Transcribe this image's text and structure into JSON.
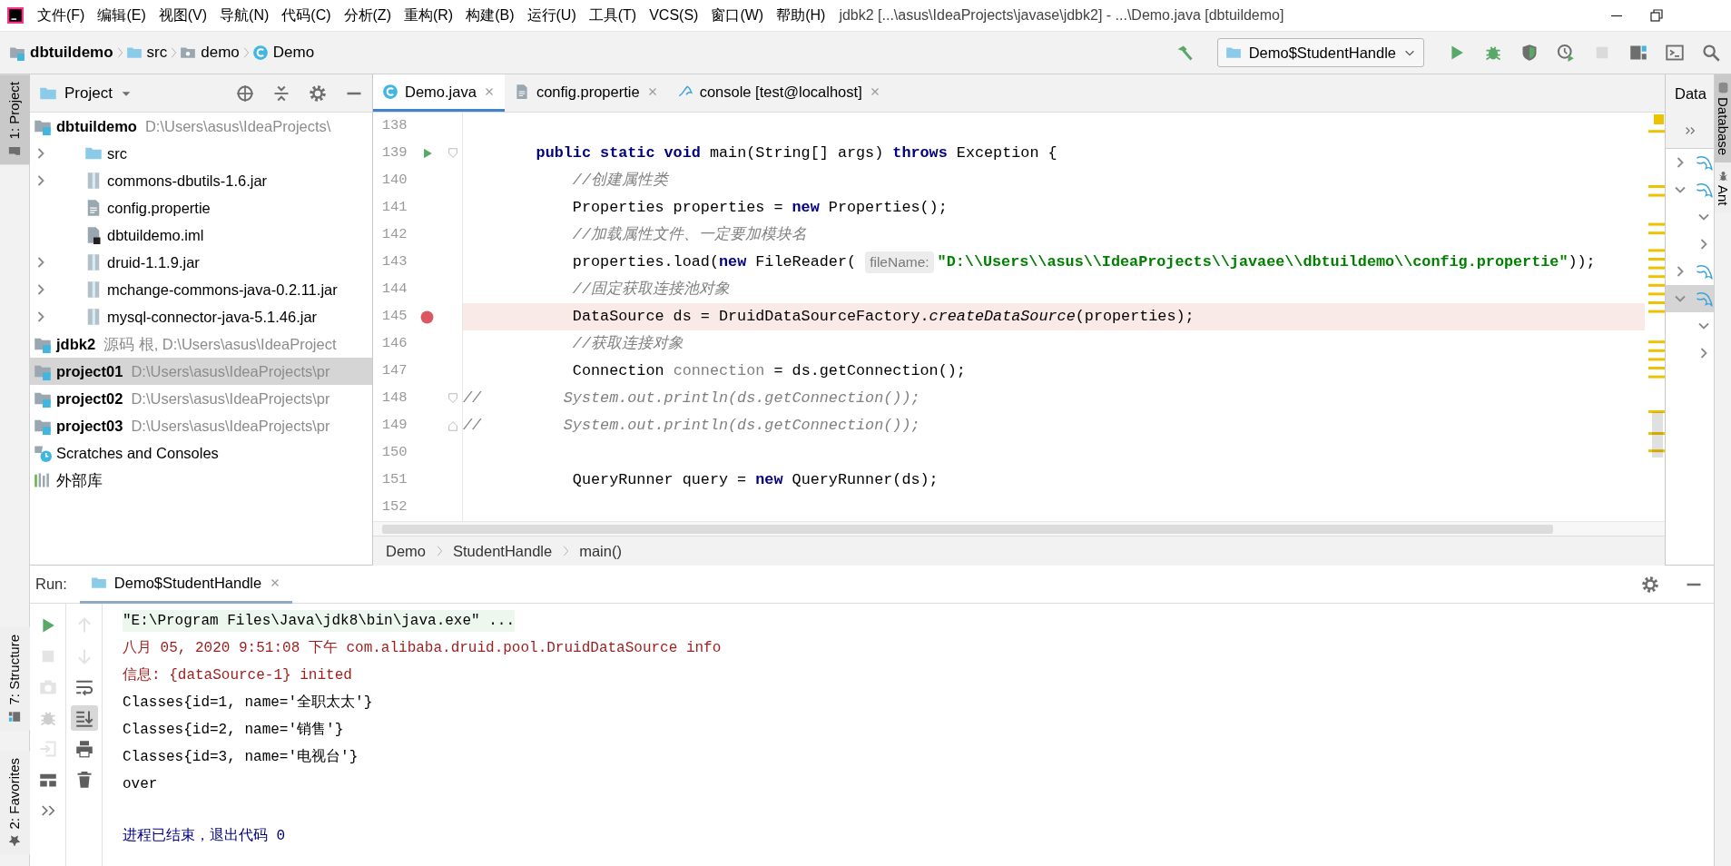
{
  "app_menu": [
    "文件(F)",
    "编辑(E)",
    "视图(V)",
    "导航(N)",
    "代码(C)",
    "分析(Z)",
    "重构(R)",
    "构建(B)",
    "运行(U)",
    "工具(T)",
    "VCS(S)",
    "窗口(W)",
    "帮助(H)"
  ],
  "window_title": "jdbk2 [...\\asus\\IdeaProjects\\javase\\jdbk2] - ...\\Demo.java [dbtuildemo]",
  "breadcrumb": [
    {
      "label": "dbtuildemo",
      "kind": "module"
    },
    {
      "label": "src",
      "kind": "folder"
    },
    {
      "label": "demo",
      "kind": "package"
    },
    {
      "label": "Demo",
      "kind": "class"
    }
  ],
  "run_config": "Demo$StudentHandle",
  "toolbar": [
    {
      "kind": "build",
      "disabled": false
    },
    {
      "kind": "run",
      "disabled": false
    },
    {
      "kind": "debug",
      "disabled": false
    },
    {
      "kind": "coverage",
      "disabled": false
    },
    {
      "kind": "profile",
      "disabled": false
    },
    {
      "kind": "stop",
      "disabled": true
    },
    {
      "kind": "structure",
      "disabled": false
    },
    {
      "kind": "terminal",
      "disabled": false
    },
    {
      "kind": "search",
      "disabled": false
    }
  ],
  "left_stripe": [
    {
      "label": "1: Project",
      "kind": "project",
      "selected": true
    },
    {
      "label": "7: Structure",
      "kind": "structure",
      "selected": false
    },
    {
      "label": "2: Favorites",
      "kind": "favorites",
      "selected": false
    }
  ],
  "right_stripe": [
    {
      "label": "Database",
      "kind": "database",
      "selected": true
    },
    {
      "label": "Ant",
      "kind": "ant",
      "selected": false
    }
  ],
  "project_panel": {
    "title": "Project",
    "tree": [
      {
        "label": "dbtuildemo",
        "path": "D:\\Users\\asus\\IdeaProjects\\",
        "kind": "module",
        "selected": false,
        "children": [
          {
            "label": "src",
            "kind": "folder",
            "expanded": false,
            "selected": false
          },
          {
            "label": "commons-dbutils-1.6.jar",
            "kind": "jar",
            "expanded": false,
            "selected": false
          },
          {
            "label": "config.propertie",
            "kind": "file",
            "selected": false
          },
          {
            "label": "dbtuildemo.iml",
            "kind": "iml",
            "selected": false
          },
          {
            "label": "druid-1.1.9.jar",
            "kind": "jar",
            "expanded": false,
            "selected": false
          },
          {
            "label": "mchange-commons-java-0.2.11.jar",
            "kind": "jar",
            "expanded": false,
            "selected": false
          },
          {
            "label": "mysql-connector-java-5.1.46.jar",
            "kind": "jar",
            "expanded": false,
            "selected": false
          }
        ]
      },
      {
        "label": "jdbk2",
        "path": "源码 根, D:\\Users\\asus\\IdeaProject",
        "kind": "module",
        "selected": false
      },
      {
        "label": "project01",
        "path": "D:\\Users\\asus\\IdeaProjects\\pr",
        "kind": "module",
        "selected": true
      },
      {
        "label": "project02",
        "path": "D:\\Users\\asus\\IdeaProjects\\pr",
        "kind": "module",
        "selected": false
      },
      {
        "label": "project03",
        "path": "D:\\Users\\asus\\IdeaProjects\\pr",
        "kind": "module",
        "selected": false
      },
      {
        "label": "Scratches and Consoles",
        "kind": "scratches",
        "selected": false
      },
      {
        "label": "外部库",
        "kind": "libraries",
        "selected": false
      }
    ]
  },
  "editor_tabs": [
    {
      "label": "Demo.java",
      "kind": "class",
      "selected": true
    },
    {
      "label": "config.propertie",
      "kind": "file",
      "selected": false
    },
    {
      "label": "console [test@localhost]",
      "kind": "console",
      "selected": false
    }
  ],
  "code_lines": [
    {
      "number": "138"
    },
    {
      "number": "139",
      "run_icon": true,
      "fold_start": true,
      "tokens": [
        {
          "kind": "keyword",
          "text": "        public static void"
        },
        {
          "kind": "plain",
          "text": " main(String[] args) "
        },
        {
          "kind": "keyword",
          "text": "throws"
        },
        {
          "kind": "plain",
          "text": " Exception {"
        }
      ]
    },
    {
      "number": "140",
      "tokens": [
        {
          "kind": "comment",
          "text": "            //创建属性类"
        }
      ]
    },
    {
      "number": "141",
      "tokens": [
        {
          "kind": "plain",
          "text": "            Properties properties = "
        },
        {
          "kind": "keyword",
          "text": "new"
        },
        {
          "kind": "plain",
          "text": " Properties();"
        }
      ]
    },
    {
      "number": "142",
      "tokens": [
        {
          "kind": "comment",
          "text": "            //加载属性文件、一定要加模块名"
        }
      ]
    },
    {
      "number": "143",
      "tokens": [
        {
          "kind": "plain",
          "text": "            properties.load("
        },
        {
          "kind": "keyword",
          "text": "new"
        },
        {
          "kind": "plain",
          "text": " FileReader( "
        },
        {
          "kind": "hint",
          "text": "fileName:"
        },
        {
          "kind": "string",
          "text": "\"D:\\\\Users\\\\asus\\\\IdeaProjects\\\\javaee\\\\dbtuildemo\\\\config.propertie\""
        },
        {
          "kind": "plain",
          "text": "));"
        }
      ]
    },
    {
      "number": "144",
      "tokens": [
        {
          "kind": "comment",
          "text": "            //固定获取连接池对象"
        }
      ]
    },
    {
      "number": "145",
      "breakpoint": true,
      "tokens": [
        {
          "kind": "plain",
          "text": "            DataSource ds = DruidDataSourceFactory."
        },
        {
          "kind": "static",
          "text": "createDataSource"
        },
        {
          "kind": "plain",
          "text": "(properties);"
        }
      ]
    },
    {
      "number": "146",
      "tokens": [
        {
          "kind": "comment",
          "text": "            //获取连接对象"
        }
      ]
    },
    {
      "number": "147",
      "tokens": [
        {
          "kind": "plain",
          "text": "            Connection "
        },
        {
          "kind": "unused",
          "text": "connection"
        },
        {
          "kind": "plain",
          "text": " = ds.getConnection();"
        }
      ]
    },
    {
      "number": "148",
      "fold_start": true,
      "tokens": [
        {
          "kind": "comment",
          "text": "//         System.out.println(ds.getConnection());"
        }
      ]
    },
    {
      "number": "149",
      "fold_end": true,
      "tokens": [
        {
          "kind": "comment",
          "text": "//         System.out.println(ds.getConnection());"
        }
      ]
    },
    {
      "number": "150"
    },
    {
      "number": "151",
      "tokens": [
        {
          "kind": "plain",
          "text": "            QueryRunner query = "
        },
        {
          "kind": "keyword",
          "text": "new"
        },
        {
          "kind": "plain",
          "text": " QueryRunner(ds);"
        }
      ]
    },
    {
      "number": "152"
    }
  ],
  "code_breadcrumb": [
    "Demo",
    "StudentHandle",
    "main()"
  ],
  "database_panel": {
    "title": "Data",
    "nodes": [
      {
        "expanded": false,
        "selected": false
      },
      {
        "expanded": true,
        "selected": false,
        "children": [
          {
            "expanded": true
          },
          {
            "expanded": false
          }
        ]
      },
      {
        "expanded": false,
        "selected": false
      },
      {
        "expanded": true,
        "selected": true,
        "children": [
          {
            "expanded": true
          },
          {
            "expanded": false
          }
        ]
      }
    ]
  },
  "run_panel": {
    "title": "Run:",
    "tab": "Demo$StudentHandle",
    "tools_left": [
      {
        "kind": "rerun",
        "disabled": false
      },
      {
        "kind": "stop",
        "disabled": true
      },
      {
        "kind": "snapshot",
        "disabled": true
      },
      {
        "kind": "debug",
        "disabled": true
      },
      {
        "kind": "login",
        "disabled": true
      },
      {
        "kind": "layout",
        "disabled": false
      },
      {
        "kind": "more",
        "disabled": false
      }
    ],
    "tools_right": [
      {
        "kind": "up",
        "disabled": true,
        "on": false
      },
      {
        "kind": "down",
        "disabled": true,
        "on": false
      },
      {
        "kind": "wrap",
        "disabled": false,
        "on": false
      },
      {
        "kind": "scroll_end",
        "disabled": false,
        "on": true
      },
      {
        "kind": "print",
        "disabled": false,
        "on": false
      },
      {
        "kind": "trash",
        "disabled": false,
        "on": false
      }
    ],
    "output": [
      {
        "kind": "command",
        "text": "\"E:\\Program Files\\Java\\jdk8\\bin\\java.exe\" ..."
      },
      {
        "kind": "stderr",
        "text": "八月 05, 2020 9:51:08 下午 com.alibaba.druid.pool.DruidDataSource info"
      },
      {
        "kind": "stderr",
        "text": "信息: {dataSource-1} inited"
      },
      {
        "kind": "stdout",
        "text": "Classes{id=1, name='全职太太'}"
      },
      {
        "kind": "stdout",
        "text": "Classes{id=2, name='销售'}"
      },
      {
        "kind": "stdout",
        "text": "Classes{id=3, name='电视台'}"
      },
      {
        "kind": "stdout",
        "text": "over"
      },
      {
        "kind": "exit",
        "text": "进程已结束，退出代码 0"
      }
    ]
  }
}
